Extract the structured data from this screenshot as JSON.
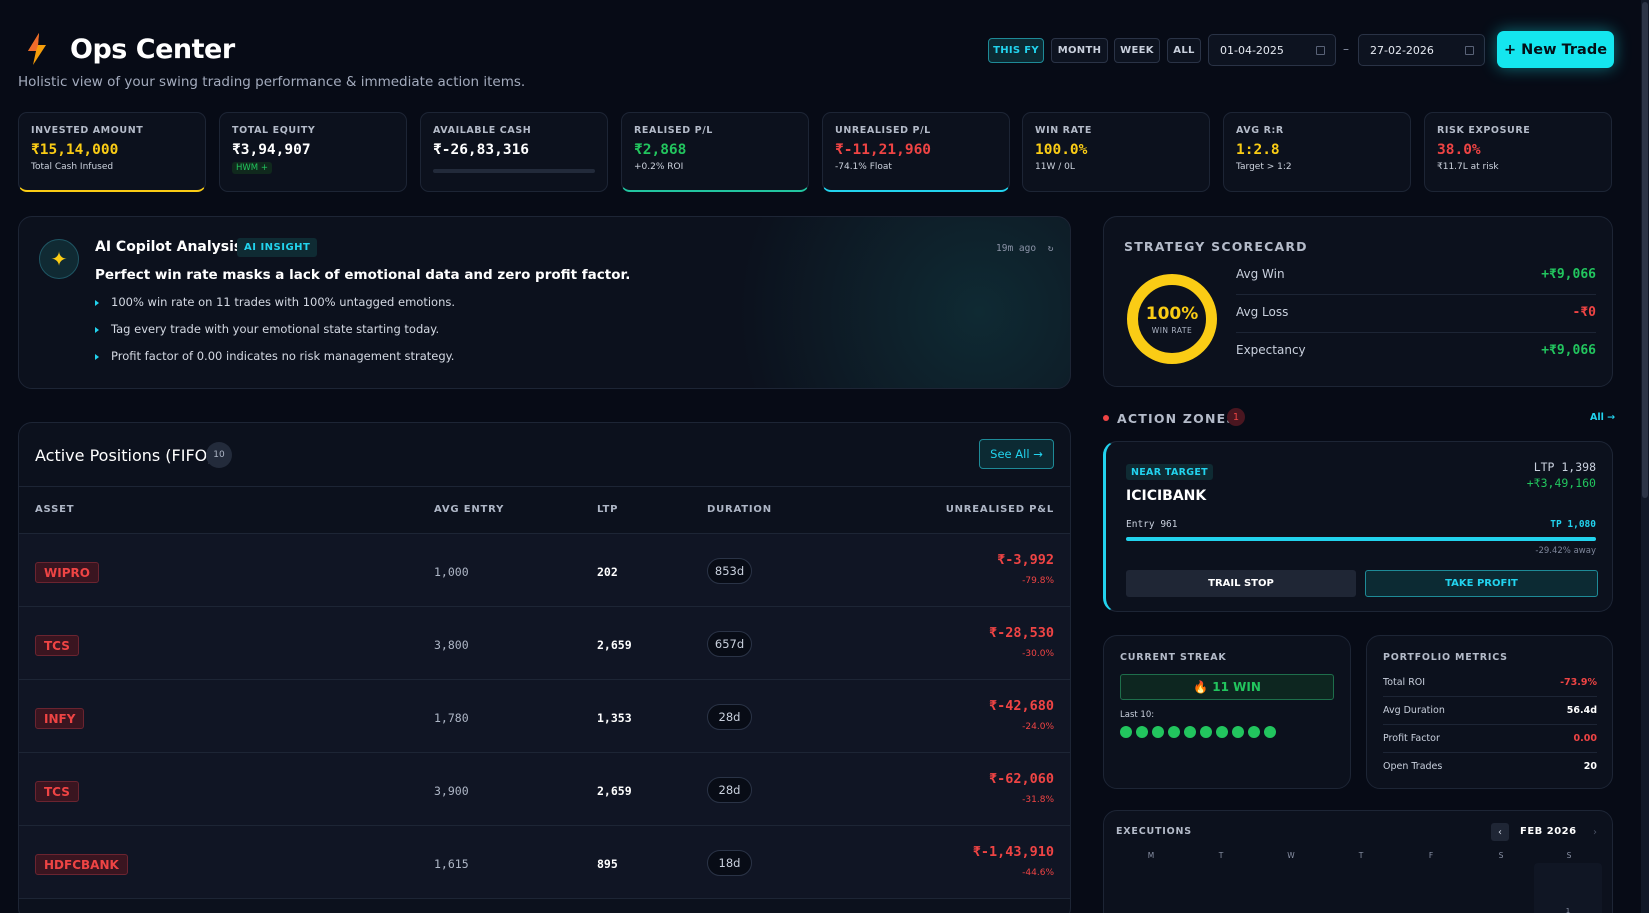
{
  "header": {
    "title": "Ops Center",
    "subtitle": "Holistic view of your swing trading performance & immediate action items.",
    "filters": [
      "THIS FY",
      "MONTH",
      "WEEK",
      "ALL"
    ],
    "date_from": "01-04-2025",
    "date_sep": "–",
    "date_to": "27-02-2026",
    "new_trade": "+ New Trade"
  },
  "stats": [
    {
      "label": "INVESTED AMOUNT",
      "value": "₹15,14,000",
      "sub": "Total Cash Infused"
    },
    {
      "label": "TOTAL EQUITY",
      "value": "₹3,94,907",
      "sub": "HWM +"
    },
    {
      "label": "AVAILABLE CASH",
      "value": "₹-26,83,316",
      "sub": ""
    },
    {
      "label": "REALISED P/L",
      "value": "₹2,868",
      "sub": "+0.2% ROI"
    },
    {
      "label": "UNREALISED P/L",
      "value": "₹-11,21,960",
      "sub": "-74.1% Float"
    },
    {
      "label": "WIN RATE",
      "value": "100.0%",
      "sub": "11W / 0L"
    },
    {
      "label": "AVG R:R",
      "value": "1:2.8",
      "sub": "Target > 1:2"
    },
    {
      "label": "RISK EXPOSURE",
      "value": "38.0%",
      "sub": "₹11.7L at risk"
    }
  ],
  "copilot": {
    "title": "AI Copilot Analysis",
    "badge": "AI INSIGHT",
    "time": "19m ago",
    "refresh": "↻",
    "headline": "Perfect win rate masks a lack of emotional data and zero profit factor.",
    "bullets": [
      "100% win rate on 11 trades with 100% untagged emotions.",
      "Tag every trade with your emotional state starting today.",
      "Profit factor of 0.00 indicates no risk management strategy."
    ]
  },
  "positions": {
    "title": "Active Positions (FIFO)",
    "count": "10",
    "see_all": "See All →",
    "columns": [
      "ASSET",
      "AVG ENTRY",
      "LTP",
      "DURATION",
      "UNREALISED P&L"
    ],
    "rows": [
      {
        "asset": "WIPRO",
        "entry": "1,000",
        "ltp": "202",
        "duration": "853d",
        "pnl": "₹-3,992",
        "pct": "-79.8%"
      },
      {
        "asset": "TCS",
        "entry": "3,800",
        "ltp": "2,659",
        "duration": "657d",
        "pnl": "₹-28,530",
        "pct": "-30.0%"
      },
      {
        "asset": "INFY",
        "entry": "1,780",
        "ltp": "1,353",
        "duration": "28d",
        "pnl": "₹-42,680",
        "pct": "-24.0%"
      },
      {
        "asset": "TCS",
        "entry": "3,900",
        "ltp": "2,659",
        "duration": "28d",
        "pnl": "₹-62,060",
        "pct": "-31.8%"
      },
      {
        "asset": "HDFCBANK",
        "entry": "1,615",
        "ltp": "895",
        "duration": "18d",
        "pnl": "₹-1,43,910",
        "pct": "-44.6%"
      }
    ]
  },
  "scorecard": {
    "title": "STRATEGY SCORECARD",
    "win_pct": "100%",
    "win_label": "WIN RATE",
    "win_fraction": 1.0,
    "rows": [
      {
        "k": "Avg Win",
        "v": "+₹9,066"
      },
      {
        "k": "Avg Loss",
        "v": "-₹0"
      },
      {
        "k": "Expectancy",
        "v": "+₹9,066"
      }
    ]
  },
  "action_zones": {
    "title": "ACTION ZONES",
    "count": "1",
    "all": "All →",
    "badge": "NEAR TARGET",
    "symbol": "ICICIBANK",
    "ltp": "LTP 1,398",
    "upnl": "+₹3,49,160",
    "entry": "Entry 961",
    "tp": "TP 1,080",
    "progress": 1.0,
    "away": "-29.42% away",
    "trail": "TRAIL STOP",
    "take_profit": "TAKE PROFIT"
  },
  "streak": {
    "title": "CURRENT STREAK",
    "value": "🔥 11 WIN",
    "last_label": "Last 10:",
    "last10": [
      "W",
      "W",
      "W",
      "W",
      "W",
      "W",
      "W",
      "W",
      "W",
      "W"
    ]
  },
  "metrics": {
    "title": "PORTFOLIO METRICS",
    "rows": [
      {
        "k": "Total ROI",
        "v": "-73.9%"
      },
      {
        "k": "Avg Duration",
        "v": "56.4d"
      },
      {
        "k": "Profit Factor",
        "v": "0.00"
      },
      {
        "k": "Open Trades",
        "v": "20"
      }
    ]
  },
  "executions": {
    "title": "EXECUTIONS",
    "prev": "‹",
    "next": "›",
    "month": "FEB 2026",
    "weekdays": [
      "M",
      "T",
      "W",
      "T",
      "F",
      "S",
      "S"
    ],
    "first_day": "1"
  },
  "colors": {
    "accent": "#22d3ee",
    "positive": "#22c55e",
    "negative": "#ef4444",
    "warn": "#facc15",
    "bg": "#070b16"
  }
}
